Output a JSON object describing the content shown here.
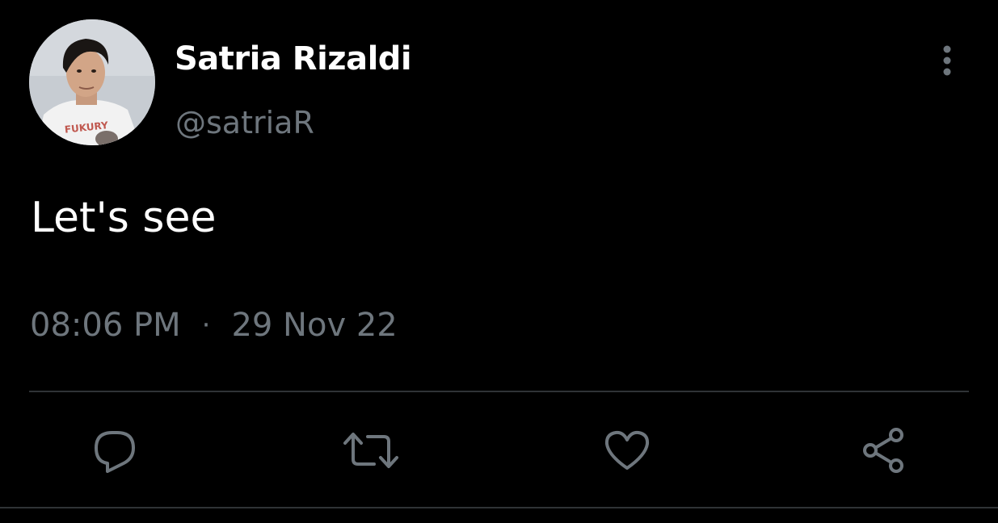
{
  "author": {
    "display_name": "Satria Rizaldi",
    "handle": "@satriaR",
    "avatar_shirt_text": "FUKURY"
  },
  "tweet": {
    "text": "Let's see",
    "time": "08:06 PM",
    "separator": "·",
    "date": "29 Nov 22"
  },
  "actions": [
    {
      "icon": "reply-icon"
    },
    {
      "icon": "retweet-icon"
    },
    {
      "icon": "like-icon"
    },
    {
      "icon": "share-icon"
    }
  ],
  "colors": {
    "background": "#000000",
    "text_primary": "#ffffff",
    "text_secondary": "#6e767d",
    "divider": "#2f3336"
  }
}
